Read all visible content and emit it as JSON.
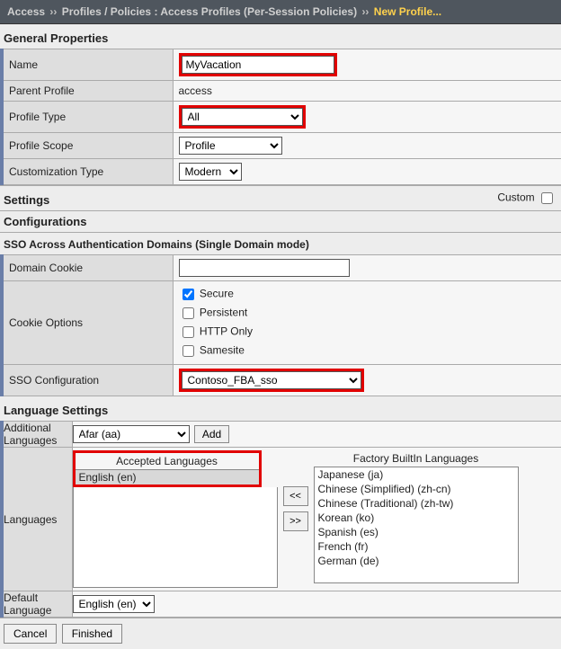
{
  "breadcrumb": {
    "root": "Access",
    "mid": "Profiles / Policies : Access Profiles (Per-Session Policies)",
    "leaf": "New Profile...",
    "sep": "››"
  },
  "sections": {
    "general": "General Properties",
    "settings": "Settings",
    "custom_label": "Custom",
    "configurations": "Configurations",
    "sso_header": "SSO Across Authentication Domains (Single Domain mode)",
    "language_settings": "Language Settings"
  },
  "general": {
    "name_label": "Name",
    "name_value": "MyVacation",
    "parent_label": "Parent Profile",
    "parent_value": "access",
    "type_label": "Profile Type",
    "type_value": "All",
    "scope_label": "Profile Scope",
    "scope_value": "Profile",
    "custom_label": "Customization Type",
    "custom_value": "Modern"
  },
  "sso": {
    "domain_cookie_label": "Domain Cookie",
    "domain_cookie_value": "",
    "cookie_options_label": "Cookie Options",
    "secure": "Secure",
    "persistent": "Persistent",
    "http_only": "HTTP Only",
    "samesite": "Samesite",
    "config_label": "SSO Configuration",
    "config_value": "Contoso_FBA_sso"
  },
  "lang": {
    "additional_label": "Additional Languages",
    "additional_value": "Afar (aa)",
    "add_btn": "Add",
    "languages_label": "Languages",
    "accepted_title": "Accepted Languages",
    "factory_title": "Factory BuiltIn Languages",
    "accepted_items": [
      "English (en)"
    ],
    "factory_items": [
      "Japanese (ja)",
      "Chinese (Simplified) (zh-cn)",
      "Chinese (Traditional) (zh-tw)",
      "Korean (ko)",
      "Spanish (es)",
      "French (fr)",
      "German (de)"
    ],
    "move_left": "<<",
    "move_right": ">>",
    "default_label": "Default Language",
    "default_value": "English (en)"
  },
  "footer": {
    "cancel": "Cancel",
    "finished": "Finished"
  }
}
